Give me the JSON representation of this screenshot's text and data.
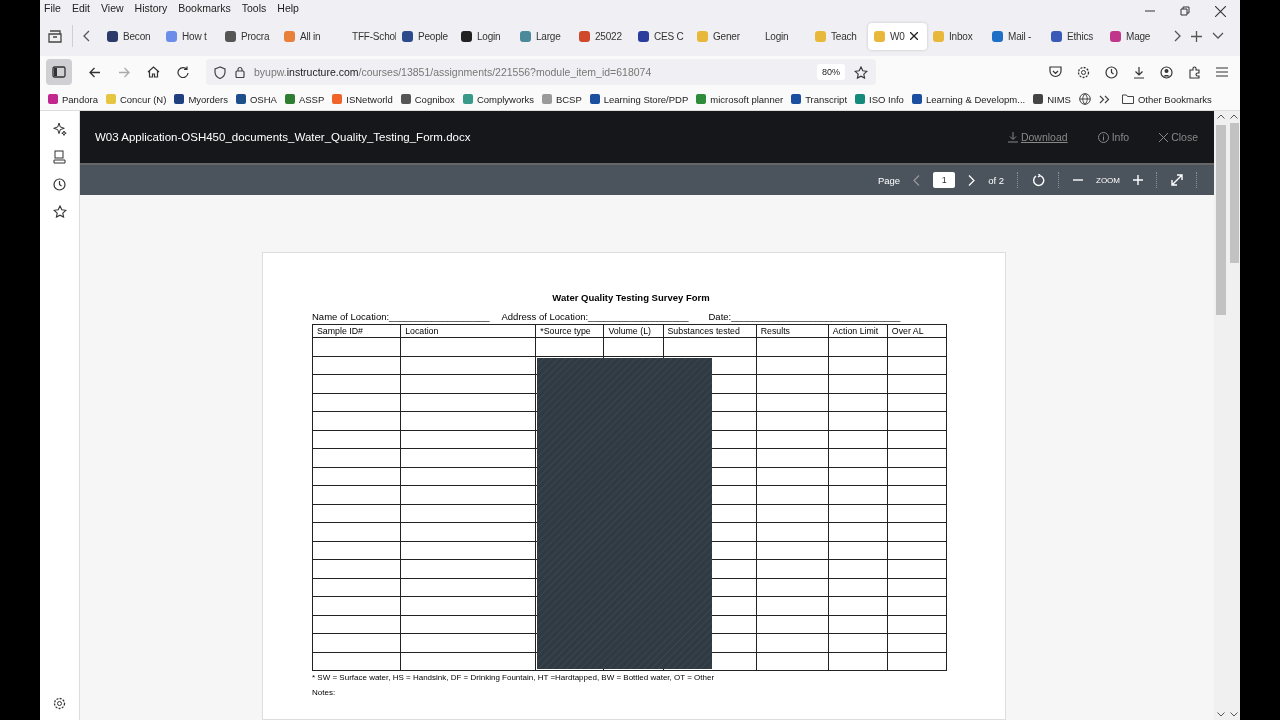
{
  "menu": [
    "File",
    "Edit",
    "View",
    "History",
    "Bookmarks",
    "Tools",
    "Help"
  ],
  "tabs": [
    {
      "title": "Becon",
      "selected": false,
      "color": "#2b3a6b"
    },
    {
      "title": "How t",
      "selected": false,
      "color": "#6c8ee8"
    },
    {
      "title": "Procra",
      "selected": false,
      "color": "#555555"
    },
    {
      "title": "All in",
      "selected": false,
      "color": "#e8803a"
    },
    {
      "title": "TFF-Schol",
      "selected": false
    },
    {
      "title": "People",
      "selected": false,
      "color": "#2c4a8c"
    },
    {
      "title": "Login",
      "selected": false,
      "color": "#222222"
    },
    {
      "title": "Large",
      "selected": false,
      "color": "#4a8a9a"
    },
    {
      "title": "25022",
      "selected": false,
      "color": "#d0492b"
    },
    {
      "title": "CES C",
      "selected": false,
      "color": "#2c3c9c"
    },
    {
      "title": "Gener",
      "selected": false,
      "color": "#e8b83a"
    },
    {
      "title": "Login",
      "selected": false
    },
    {
      "title": "Teach",
      "selected": false,
      "color": "#e8b83a"
    },
    {
      "title": "W0",
      "selected": true,
      "color": "#e8b83a"
    },
    {
      "title": "Inbox",
      "selected": false,
      "color": "#e8b83a"
    },
    {
      "title": "Mail -",
      "selected": false,
      "color": "#1f6fc6"
    },
    {
      "title": "Ethics",
      "selected": false,
      "color": "#3a5ab8"
    },
    {
      "title": "Mage",
      "selected": false,
      "color": "#c0368a"
    }
  ],
  "address": {
    "host_prefix": "byupw.",
    "host_domain": "instructure.com",
    "path": "/courses/13851/assignments/221556?module_item_id=618074",
    "zoom": "80%"
  },
  "bookmarks": [
    {
      "label": "Pandora",
      "color": "#c2278f"
    },
    {
      "label": "Concur (N)",
      "color": "#e6c640"
    },
    {
      "label": "Myorders",
      "color": "#1f3f7f"
    },
    {
      "label": "OSHA",
      "color": "#1c4f8a"
    },
    {
      "label": "ASSP",
      "color": "#2e7d32"
    },
    {
      "label": "ISNetworld",
      "color": "#f0642a"
    },
    {
      "label": "Cognibox",
      "color": "#555555"
    },
    {
      "label": "Complyworks",
      "color": "#3a9a8a"
    },
    {
      "label": "BCSP",
      "color": "#9a9a9a"
    },
    {
      "label": "Learning Store/PDP",
      "color": "#1a4fa0"
    },
    {
      "label": "microsoft planner",
      "color": "#2e8b3a"
    },
    {
      "label": "Transcript",
      "color": "#1a4fa0"
    },
    {
      "label": "ISO Info",
      "color": "#138a7a"
    },
    {
      "label": "Learning & Developm...",
      "color": "#1a4fa0"
    },
    {
      "label": "NIMS",
      "color": "#444444"
    }
  ],
  "other_bookmarks": "Other Bookmarks",
  "viewer": {
    "title": "W03 Application-OSH450_documents_Water_Quality_Testing_Form.docx",
    "actions": [
      {
        "label": "Download",
        "kind": "download"
      },
      {
        "label": "Info",
        "kind": "info"
      },
      {
        "label": "Close",
        "kind": "close"
      }
    ],
    "page_label": "Page",
    "page": "1",
    "page_total": "of 2",
    "zoom_label": "ZOOM"
  },
  "document": {
    "title": "Water Quality Testing Survey Form",
    "fields": [
      {
        "label": "Name of Location:",
        "line": "___________________"
      },
      {
        "label": "Address of Location:",
        "line": "___________________"
      },
      {
        "label": "Date:",
        "line": "________________________________"
      }
    ],
    "columns": [
      "Sample ID#",
      "Location",
      "*Source type",
      "Volume (L)",
      "Substances tested",
      "Results",
      "Action Limit",
      "Over AL"
    ],
    "footnote": "* SW = Surface water, HS = Handsink, DF = Drinking Fountain, HT =Hardtapped, BW = Bottled water, OT = Other",
    "notes_label": "Notes:"
  }
}
